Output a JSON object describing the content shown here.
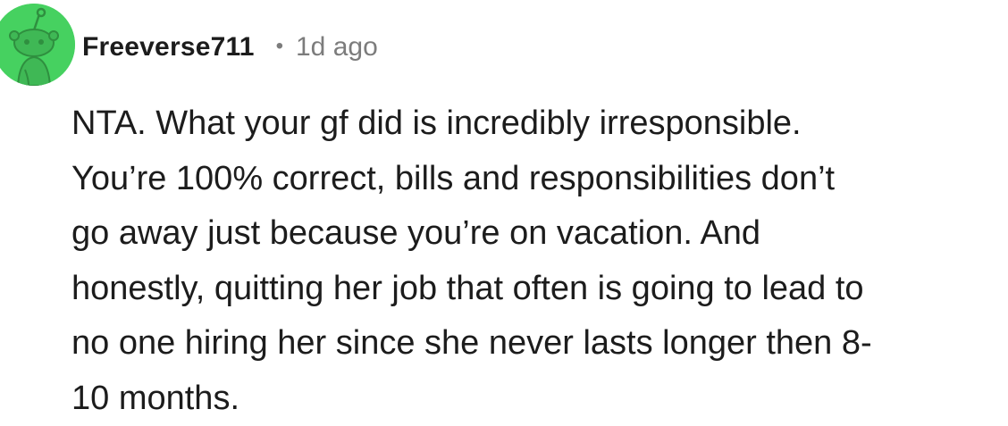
{
  "comment": {
    "avatar_icon": "snoo-avatar-icon",
    "avatar_color": "#46d160",
    "username": "Freeverse711",
    "separator": "•",
    "timestamp": "1d ago",
    "body_lines": [
      "NTA. What your gf did is incredibly irresponsible.",
      "You’re 100% correct, bills and responsibilities don’t",
      "go away just because you’re on vacation. And",
      "honestly, quitting her job that often is going to lead to",
      "no one hiring her since she never lasts longer then 8-",
      "10 months."
    ]
  }
}
